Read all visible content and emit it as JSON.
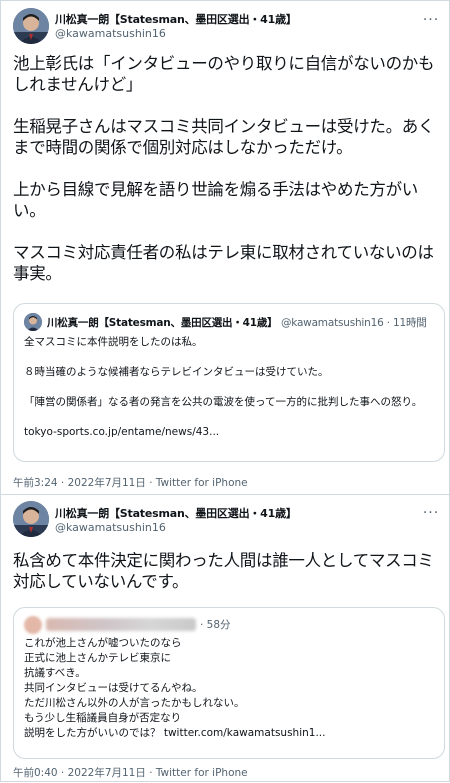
{
  "tweet1": {
    "name": "川松真一朗【Statesman、墨田区選出・41歳】",
    "handle": "@kawamatsushin16",
    "more_label": "···",
    "body": "池上彰氏は「インタビューのやり取りに自信がないのかもしれませんけど」\n\n生稲晃子さんはマスコミ共同インタビューは受けた。あくまで時間の関係で個別対応はしなかっただけ。\n\n上から目線で見解を語り世論を煽る手法はやめた方がいい。\n\nマスコミ対応責任者の私はテレ東に取材されていないのは事実。",
    "quote": {
      "name": "川松真一朗【Statesman、墨田区選出・41歳】",
      "handle_time": "@kawamatsushin16 · 11時間",
      "text": "全マスコミに本件説明をしたのは私。\n\n８時当確のような候補者ならテレビインタビューは受けていた。\n\n「陣営の関係者」なる者の発言を公共の電波を使って一方的に批判した事への怒り。\n\ntokyo-sports.co.jp/entame/news/43..."
    },
    "meta": "午前3:24 · 2022年7月11日 · Twitter for iPhone"
  },
  "tweet2": {
    "name": "川松真一朗【Statesman、墨田区選出・41歳】",
    "handle": "@kawamatsushin16",
    "more_label": "···",
    "body": "私含めて本件決定に関わった人間は誰一人としてマスコミ対応していないんです。",
    "quote": {
      "time": "· 58分",
      "text": "これが池上さんが嘘ついたのなら\n正式に池上さんかテレビ東京に\n抗議すべき。\n共同インタビューは受けてるんやね。\nただ川松さん以外の人が言ったかもしれない。\nもう少し生稲議員自身が否定なり\n説明をした方がいいのでは？ twitter.com/kawamatsushin1..."
    },
    "meta": "午前0:40 · 2022年7月11日 · Twitter for iPhone"
  }
}
